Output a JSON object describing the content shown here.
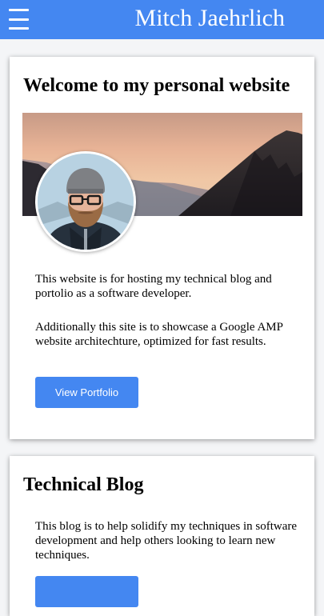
{
  "header": {
    "title": "Mitch Jaehrlich",
    "menu_icon": "hamburger-menu-icon",
    "background_color": "#4487f1"
  },
  "welcome_card": {
    "heading": "Welcome to my personal website",
    "banner_image": "mountain-sunset-banner",
    "avatar_image": "profile-photo",
    "paragraph_1": "This website is for hosting my technical blog and portolio as a software developer.",
    "paragraph_2": "Additionally this site is to showcase a Google AMP website architechture, optimized for fast results.",
    "button_label": "View Portfolio"
  },
  "blog_card": {
    "heading": "Technical Blog",
    "paragraph": "This blog is to help solidify my techniques in software development and help others looking to learn new techniques.",
    "button_label": ""
  },
  "colors": {
    "accent": "#4487f1",
    "page_background": "#f4f5f7",
    "card_background": "#ffffff"
  }
}
